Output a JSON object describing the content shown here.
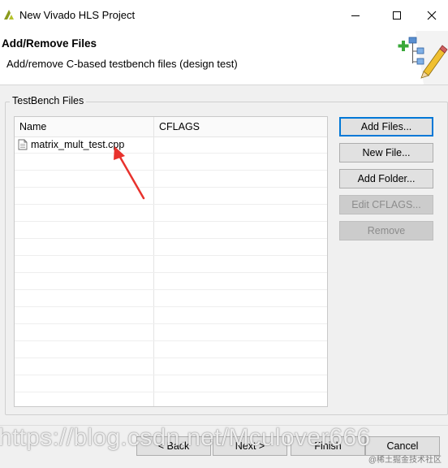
{
  "window": {
    "title": "New Vivado HLS Project",
    "minimize_icon": "minimize-icon",
    "maximize_icon": "maximize-icon",
    "close_icon": "close-icon"
  },
  "header": {
    "title": "Add/Remove Files",
    "description": "Add/remove C-based testbench files (design test)",
    "icon": "add-files-wizard-icon"
  },
  "group": {
    "label": "TestBench Files"
  },
  "table": {
    "columns": [
      "Name",
      "CFLAGS"
    ],
    "rows": [
      {
        "name": "matrix_mult_test.cpp",
        "cflags": "",
        "icon": "file-icon"
      }
    ]
  },
  "buttons": {
    "add_files": "Add Files...",
    "new_file": "New File...",
    "add_folder": "Add Folder...",
    "edit_cflags": "Edit CFLAGS...",
    "remove": "Remove"
  },
  "footer": {
    "back": "< Back",
    "next": "Next >",
    "finish": "Finish",
    "cancel": "Cancel"
  },
  "watermark": {
    "url": "https://blog.csdn.net/Mculover666",
    "small": "@稀土掘金技术社区"
  },
  "colors": {
    "accent": "#0078d7",
    "annotation_arrow": "#e8322d",
    "app_icon": "#8a9a1c"
  }
}
